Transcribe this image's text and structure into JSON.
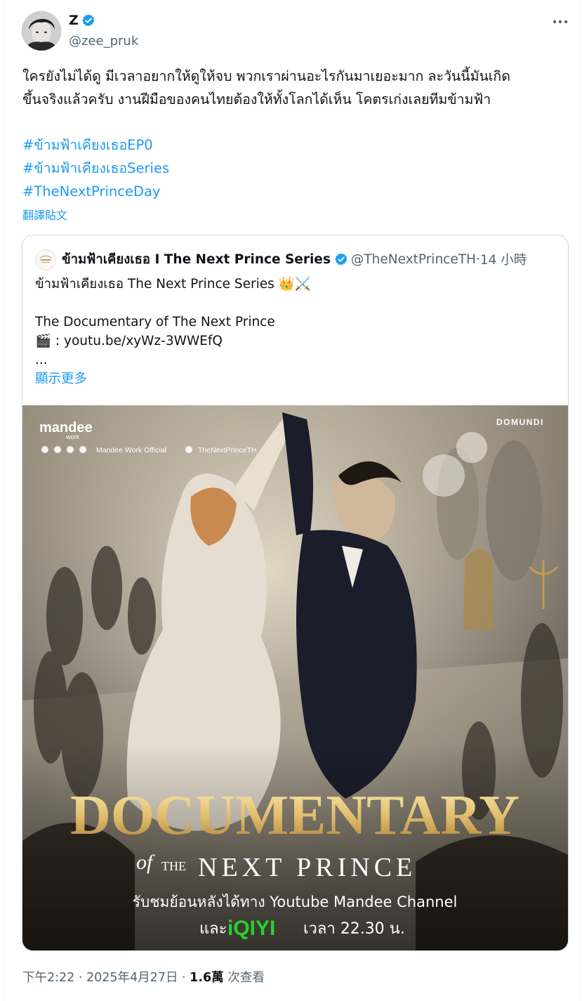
{
  "author": {
    "display_name": "Z",
    "handle": "@zee_pruk",
    "verified": true
  },
  "menu_icon": "more-horizontal-icon",
  "tweet": {
    "lines": [
      "ใครยังไม่ได้ดู มีเวลาอยากให้ดูให้จบ พวกเราผ่านอะไรกันมาเยอะมาก ละวันนี้มันเกิด",
      "ขึ้นจริงแล้วครับ งานฝีมือของคนไทยต้องให้ทั้งโลกได้เห็น โคตรเก่งเลยทีมข้ามฟ้า"
    ],
    "hashtags": [
      "#ข้ามฟ้าเคียงเธอEP0",
      "#ข้ามฟ้าเคียงเธอSeries",
      "#TheNextPrinceDay"
    ],
    "translate_label": "翻譯貼文"
  },
  "quoted": {
    "display_name": "ข้ามฟ้าเคียงเธอ I The Next Prince Series",
    "handle": "@TheNextPrinceTH",
    "separator": " · ",
    "time": "14 小時",
    "body": [
      "ข้ามฟ้าเคียงเธอ The Next Prince Series 👑⚔️",
      "",
      "The Documentary of The Next Prince",
      "🎬 : youtu.be/xyWz-3WWEfQ",
      "..."
    ],
    "show_more": "顯示更多",
    "poster": {
      "brand_logo": "mandee",
      "brand_sub": "work",
      "studio": "DOMUNDI",
      "socials": "Mandee Work Official",
      "x_handle": "TheNextPrinceTH",
      "title": "DOCUMENTARY",
      "subtitle_of": "of",
      "subtitle_the": "THE",
      "subtitle_main": "NEXT PRINCE",
      "thai_line1": "รับชมย้อนหลังได้ทาง Youtube Mandee Channel",
      "thai_and": "และ",
      "iqiyi": "iQIYI",
      "thai_time": "เวลา 22.30 น."
    }
  },
  "footer": {
    "time": "下午2:22",
    "sep1": " · ",
    "date": "2025年4月27日",
    "sep2": " · ",
    "views": "1.6萬",
    "views_suffix": " 次查看"
  },
  "colors": {
    "link": "#1d9bf0",
    "verified": "#1d9bf0",
    "muted": "#536471",
    "border": "#cfd9de"
  }
}
